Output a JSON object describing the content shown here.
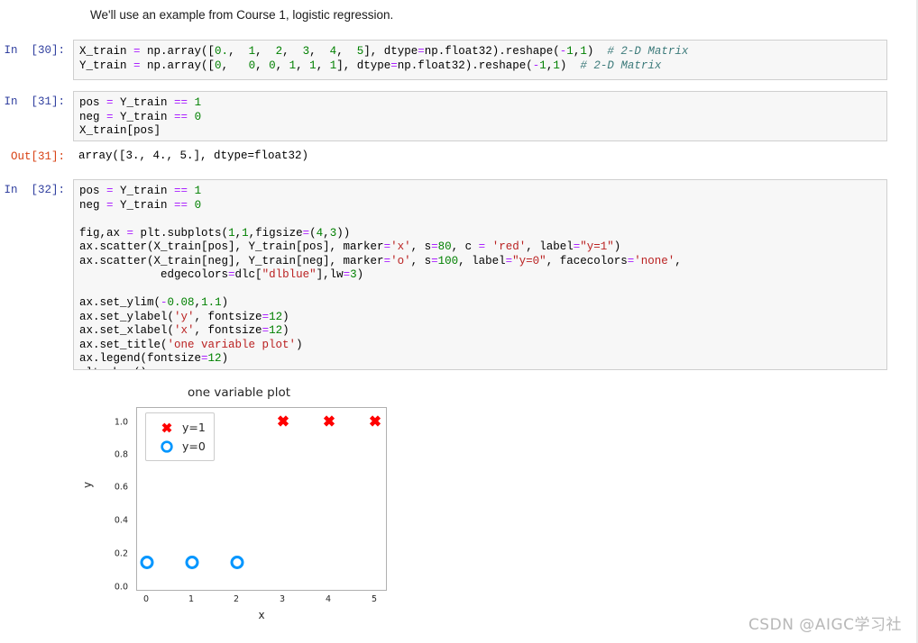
{
  "notebook": {
    "markdown_text": "We'll use an example from Course 1, logistic regression.",
    "cells": [
      {
        "prompt": "In  [30]:",
        "kind": "in",
        "lines": [
          "X_train = np.array([0.,  1,  2,  3,  4,  5], dtype=np.float32).reshape(-1,1)  # 2-D Matrix",
          "Y_train = np.array([0,   0, 0, 1, 1, 1], dtype=np.float32).reshape(-1,1)  # 2-D Matrix"
        ]
      },
      {
        "prompt": "In  [31]:",
        "kind": "in",
        "lines": [
          "pos = Y_train == 1",
          "neg = Y_train == 0",
          "X_train[pos]"
        ]
      },
      {
        "prompt": "Out[31]:",
        "kind": "out",
        "lines": [
          "array([3., 4., 5.], dtype=float32)"
        ]
      },
      {
        "prompt": "In  [32]:",
        "kind": "in",
        "lines": [
          "pos = Y_train == 1",
          "neg = Y_train == 0",
          "",
          "fig,ax = plt.subplots(1,1,figsize=(4,3))",
          "ax.scatter(X_train[pos], Y_train[pos], marker='x', s=80, c = 'red', label=\"y=1\")",
          "ax.scatter(X_train[neg], Y_train[neg], marker='o', s=100, label=\"y=0\", facecolors='none',",
          "            edgecolors=dlc[\"dlblue\"],lw=3)",
          "",
          "ax.set_ylim(-0.08,1.1)",
          "ax.set_ylabel('y', fontsize=12)",
          "ax.set_xlabel('x', fontsize=12)",
          "ax.set_title('one variable plot')",
          "ax.legend(fontsize=12)",
          "plt.show()"
        ]
      }
    ]
  },
  "chart_data": {
    "type": "scatter",
    "title": "one variable plot",
    "xlabel": "x",
    "ylabel": "y",
    "xlim": [
      -0.25,
      5.25
    ],
    "ylim": [
      -0.08,
      1.1
    ],
    "xticks": [
      "0",
      "1",
      "2",
      "3",
      "4",
      "5"
    ],
    "xtick_values": [
      0,
      1,
      2,
      3,
      4,
      5
    ],
    "yticks": [
      "0.0",
      "0.2",
      "0.4",
      "0.6",
      "0.8",
      "1.0"
    ],
    "ytick_values": [
      0.0,
      0.2,
      0.4,
      0.6,
      0.8,
      1.0
    ],
    "grid": false,
    "legend_position": "upper left",
    "series": [
      {
        "name": "y=1",
        "marker": "x",
        "color": "#ff0000",
        "size": 80,
        "x": [
          3,
          4,
          5
        ],
        "y": [
          1,
          1,
          1
        ]
      },
      {
        "name": "y=0",
        "marker": "o",
        "color": "#0096ff",
        "facecolor": "none",
        "size": 100,
        "linewidth": 3,
        "x": [
          0,
          1,
          2
        ],
        "y": [
          0,
          0,
          0
        ]
      }
    ]
  },
  "watermark": {
    "text": "CSDN @AIGC学习社"
  },
  "colors": {
    "prompt_in": "#303f9f",
    "prompt_out": "#d84315",
    "code_bg": "#f7f7f7",
    "code_border": "#cfcfcf",
    "marker_red": "#ff0000",
    "marker_blue": "#0096ff"
  }
}
